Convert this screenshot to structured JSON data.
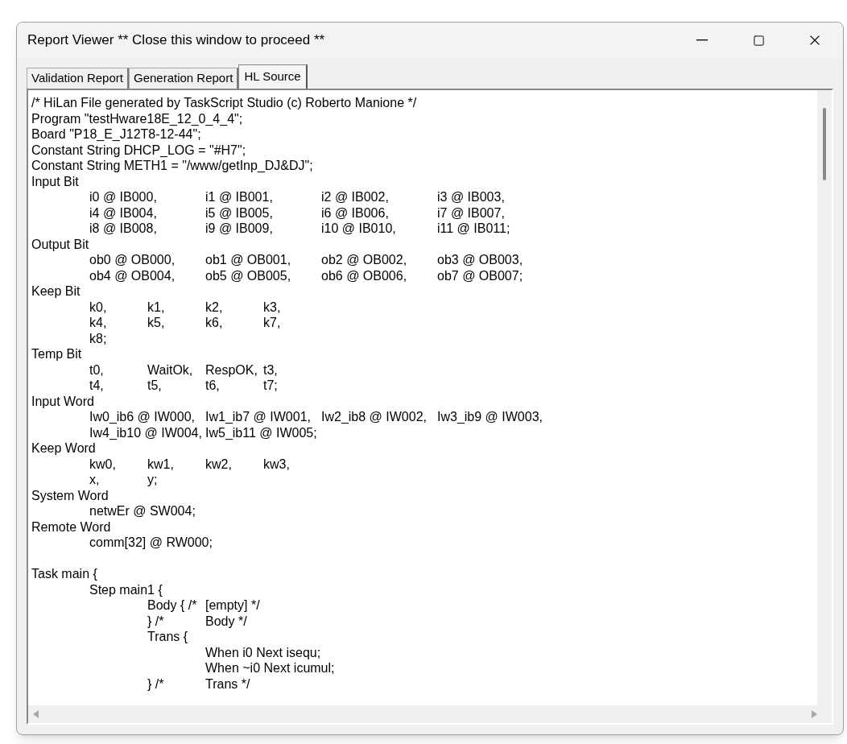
{
  "window": {
    "title": "Report Viewer ** Close this window to proceed **"
  },
  "tabs": [
    {
      "label": "Validation Report",
      "selected": false
    },
    {
      "label": "Generation Report",
      "selected": false
    },
    {
      "label": "HL Source",
      "selected": true
    }
  ],
  "source_blocks": [
    [
      "/* HiLan File generated by TaskScript Studio (c) Roberto Manione */",
      "Program \"testHware18E_12_0_4_4\";",
      "Board \"P18_E_J12T8-12-44\";",
      "Constant String DHCP_LOG = \"#H7\";",
      "Constant String METH1 = \"/www/getInp_DJ&DJ\";",
      "Input Bit",
      "\ti0 @ IB000,\ti1 @ IB001,\ti2 @ IB002,\ti3 @ IB003,",
      "\ti4 @ IB004,\ti5 @ IB005,\ti6 @ IB006,\ti7 @ IB007,",
      "\ti8 @ IB008,\ti9 @ IB009,\ti10 @ IB010,\ti11 @ IB011;",
      "Output Bit",
      "\tob0 @ OB000,\tob1 @ OB001,\tob2 @ OB002,\tob3 @ OB003,",
      "\tob4 @ OB004,\tob5 @ OB005,\tob6 @ OB006,\tob7 @ OB007;",
      "Keep Bit",
      "\tk0,\tk1,\tk2,\tk3,",
      "\tk4,\tk5,\tk6,\tk7,",
      "\tk8;",
      "Temp Bit",
      "\tt0,\tWaitOk,\tRespOK,\tt3,",
      "\tt4,\tt5,\tt6,\tt7;",
      "Input Word",
      "\tIw0_ib6 @ IW000,\tIw1_ib7 @ IW001,\tIw2_ib8 @ IW002,\tIw3_ib9 @ IW003,",
      "\tIw4_ib10 @ IW004,\tIw5_ib11 @ IW005;",
      "Keep Word",
      "\tkw0,\tkw1,\tkw2,\tkw3,",
      "\tx,\ty;",
      "System Word",
      "\tnetwEr @ SW004;",
      "Remote Word",
      "\tcomm[32] @ RW000;"
    ],
    [
      "Task main {",
      "\tStep main1 {",
      "\t\tBody { /*\t[empty] */",
      "\t\t} /*\tBody */",
      "\t\tTrans {",
      "\t\t\tWhen i0 Next isequ;",
      "\t\t\tWhen ~i0 Next icumul;",
      "\t\t} /*\tTrans */"
    ]
  ]
}
